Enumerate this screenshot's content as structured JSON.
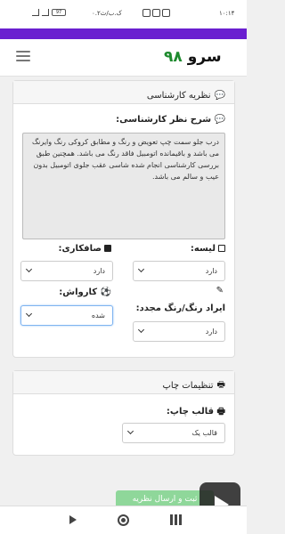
{
  "status_bar": {
    "time": "۱۰:۱۴",
    "network_speed": "۰.۲ک.ب/ث",
    "battery": "97"
  },
  "header": {
    "logo_text": "سرو",
    "logo_number": "۹۸"
  },
  "expert_card": {
    "title": "نظریه کارشناسی",
    "comment_label": "شرح نظر کارشناسی:",
    "comment_value": "درب جلو سمت چپ تعویض و رنگ و مطابق کروکی رنگ وایرنگ می باشد و باقیمانده اتومبیل فاقد رنگ می باشد. همچنین طبق بررسی کارشناسی انجام شده شاسی عقب جلوی اتومبیل بدون عیب و سالم می باشد.",
    "lise_label": "لیسه:",
    "lise_value": "دارد",
    "safkari_label": "صافکاری:",
    "safkari_value": "دارد",
    "repaint_label": "ایراد رنگ/رنگ مجدد:",
    "repaint_value": "دارد",
    "karvash_label": "کارواش:",
    "karvash_value": "شده"
  },
  "print_card": {
    "title": "تنظیمات چاپ",
    "template_label": "قالب چاپ:",
    "template_value": "قالب یک"
  },
  "footer": {
    "button_label": "ثبت و ارسال نظریه"
  },
  "colors": {
    "accent": "#6a1fd0",
    "logo_green": "#1e8a2e",
    "button_green": "#8fd79a"
  }
}
